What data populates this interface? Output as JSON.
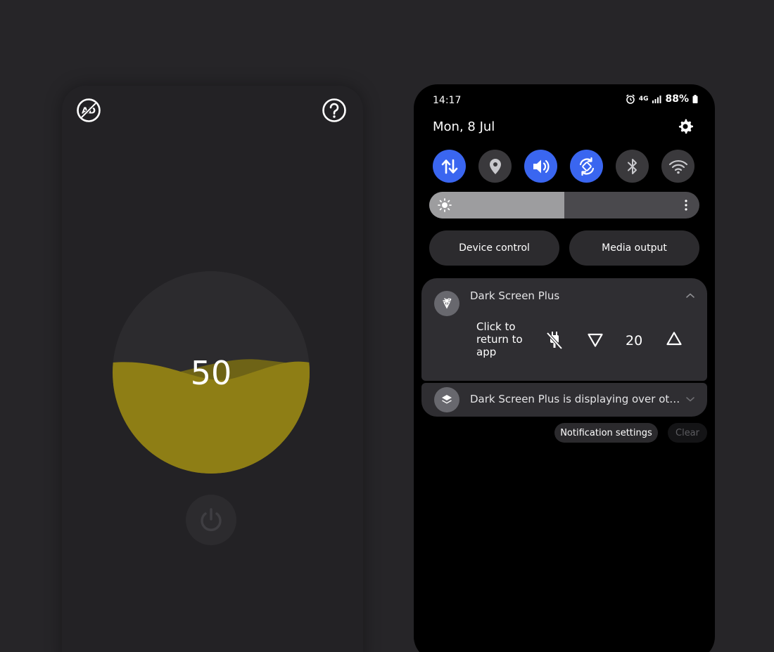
{
  "left_app": {
    "level_value": "50",
    "level_fraction": 0.5,
    "wave_color": "#8e7e15",
    "icons": {
      "top_left": "no-ads-icon",
      "top_right": "help-icon",
      "bottom": "power-icon"
    }
  },
  "panel": {
    "status_bar": {
      "time": "14:17",
      "network": "4G",
      "battery": "88%",
      "icons": [
        "alarm-icon",
        "network-icon",
        "signal-icon",
        "battery-icon"
      ]
    },
    "date": "Mon, 8 Jul",
    "quick_settings": [
      {
        "icon": "mobile-data-icon",
        "on": true
      },
      {
        "icon": "location-icon",
        "on": false
      },
      {
        "icon": "sound-icon",
        "on": true
      },
      {
        "icon": "auto-rotate-icon",
        "on": true
      },
      {
        "icon": "bluetooth-icon",
        "on": false
      },
      {
        "icon": "wifi-icon",
        "on": false
      }
    ],
    "brightness_fraction": 0.5,
    "device_control_label": "Device control",
    "media_output_label": "Media output",
    "notifications": {
      "primary": {
        "app_name": "Dark Screen Plus",
        "body": "Click to return to app",
        "count": "20"
      },
      "secondary": {
        "text": "Dark Screen Plus is displaying over othe..."
      }
    },
    "notification_settings_label": "Notification settings",
    "clear_label": "Clear",
    "accent_color": "#3a66f0"
  }
}
